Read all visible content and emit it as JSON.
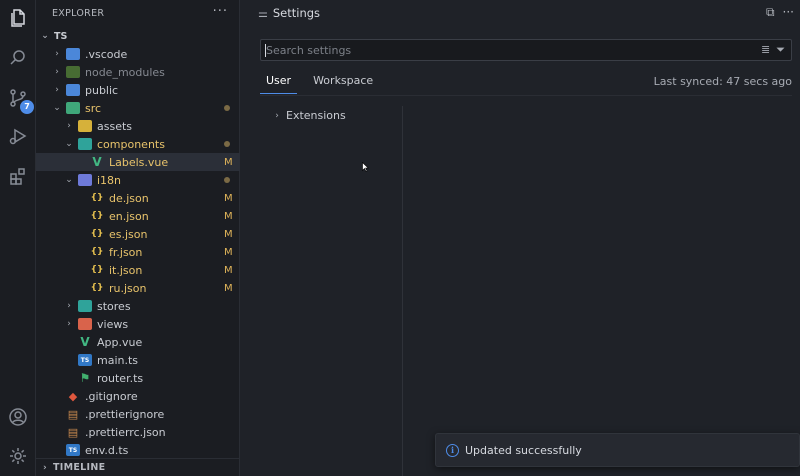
{
  "explorer": {
    "title": "EXPLORER",
    "more": "···",
    "root": "TS",
    "timeline": "TIMELINE",
    "rows": [
      {
        "label": ".vscode",
        "indent": 1,
        "chev": "›",
        "icon": "folder",
        "color": "blue",
        "status": ""
      },
      {
        "label": "node_modules",
        "indent": 1,
        "chev": "›",
        "icon": "folder",
        "color": "dim",
        "status": "",
        "dim": true
      },
      {
        "label": "public",
        "indent": 1,
        "chev": "›",
        "icon": "folder",
        "color": "blue",
        "status": ""
      },
      {
        "label": "src",
        "indent": 1,
        "chev": "⌄",
        "icon": "folder",
        "color": "green",
        "status": "dot",
        "yellow": true
      },
      {
        "label": "assets",
        "indent": 2,
        "chev": "›",
        "icon": "folder",
        "color": "yellow",
        "status": ""
      },
      {
        "label": "components",
        "indent": 2,
        "chev": "⌄",
        "icon": "folder",
        "color": "teal",
        "status": "dot",
        "yellow": true
      },
      {
        "label": "Labels.vue",
        "indent": 3,
        "chev": "",
        "icon": "vue",
        "status": "M",
        "yellow": true,
        "selected": true
      },
      {
        "label": "i18n",
        "indent": 2,
        "chev": "⌄",
        "icon": "folder",
        "color": "purple",
        "status": "dot",
        "yellow": true
      },
      {
        "label": "de.json",
        "indent": 3,
        "chev": "",
        "icon": "json",
        "status": "M",
        "yellow": true
      },
      {
        "label": "en.json",
        "indent": 3,
        "chev": "",
        "icon": "json",
        "status": "M",
        "yellow": true
      },
      {
        "label": "es.json",
        "indent": 3,
        "chev": "",
        "icon": "json",
        "status": "M",
        "yellow": true
      },
      {
        "label": "fr.json",
        "indent": 3,
        "chev": "",
        "icon": "json",
        "status": "M",
        "yellow": true
      },
      {
        "label": "it.json",
        "indent": 3,
        "chev": "",
        "icon": "json",
        "status": "M",
        "yellow": true
      },
      {
        "label": "ru.json",
        "indent": 3,
        "chev": "",
        "icon": "json",
        "status": "M",
        "yellow": true
      },
      {
        "label": "stores",
        "indent": 2,
        "chev": "›",
        "icon": "folder",
        "color": "teal",
        "status": ""
      },
      {
        "label": "views",
        "indent": 2,
        "chev": "›",
        "icon": "folder",
        "color": "red",
        "status": ""
      },
      {
        "label": "App.vue",
        "indent": 2,
        "chev": "",
        "icon": "vue",
        "status": ""
      },
      {
        "label": "main.ts",
        "indent": 2,
        "chev": "",
        "icon": "ts",
        "status": ""
      },
      {
        "label": "router.ts",
        "indent": 2,
        "chev": "",
        "icon": "router",
        "status": ""
      },
      {
        "label": ".gitignore",
        "indent": 1,
        "chev": "",
        "icon": "git",
        "status": ""
      },
      {
        "label": ".prettierignore",
        "indent": 1,
        "chev": "",
        "icon": "prettier",
        "status": ""
      },
      {
        "label": ".prettierrc.json",
        "indent": 1,
        "chev": "",
        "icon": "prettier",
        "status": ""
      },
      {
        "label": "env.d.ts",
        "indent": 1,
        "chev": "",
        "icon": "ts",
        "status": ""
      }
    ]
  },
  "activity": {
    "scm_badge": "7"
  },
  "settings": {
    "title": "Settings",
    "search_placeholder": "Search settings",
    "tabs": [
      "User",
      "Workspace"
    ],
    "active_tab": "User",
    "last_synced": "Last synced: 47 secs ago",
    "toc": [
      {
        "label": "Extensions"
      }
    ]
  },
  "toast": {
    "message": "Updated successfully"
  },
  "colors": {
    "accent": "#4e8ce8",
    "modified": "#e0b45a"
  }
}
